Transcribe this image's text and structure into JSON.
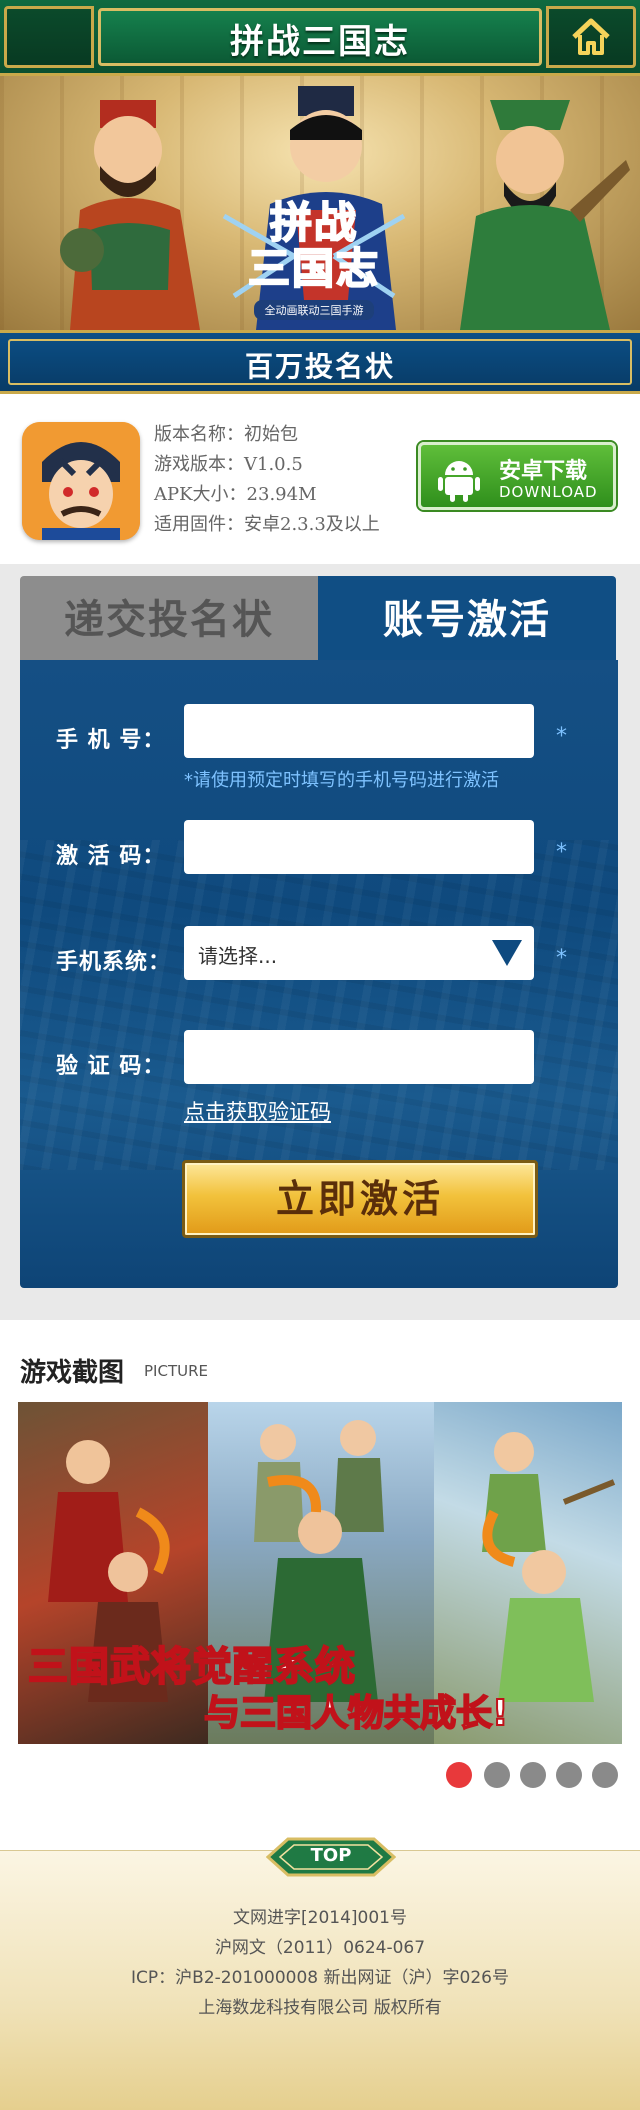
{
  "header": {
    "title": "拼战三国志"
  },
  "hero": {
    "logo_text": "拼战\n三国志",
    "logo_sub": "全动画联动三国手游"
  },
  "ribbon": {
    "label": "百万投名状"
  },
  "app": {
    "version_name": "版本名称：初始包",
    "game_version": "游戏版本：V1.0.5",
    "apk_size": "APK大小：23.94M",
    "firmware": "适用固件：安卓2.3.3及以上",
    "download_cn": "安卓下载",
    "download_en": "DOWNLOAD"
  },
  "tabs": {
    "submit": "递交投名状",
    "activate": "账号激活"
  },
  "form": {
    "phone_label": "手 机 号：",
    "phone_hint": "*请使用预定时填写的手机号码进行激活",
    "code_label": "激 活 码：",
    "os_label": "手机系统：",
    "os_selected": "请选择...",
    "captcha_label": "验 证 码：",
    "get_captcha": "点击获取验证码",
    "required_mark": "*",
    "activate_button": "立即激活"
  },
  "screenshots": {
    "heading": "游戏截图",
    "heading_en": "PICTURE",
    "caption1": "三国武将觉醒系统",
    "caption2": "与三国人物共成长!",
    "dots_count": 5,
    "active_dot": 1
  },
  "footer": {
    "top_label": "TOP",
    "line1": "文网进字[2014]001号",
    "line2": "沪网文（2011）0624-067",
    "line3": "ICP：沪B2-201000008 新出网证（沪）字026号",
    "line4": "上海数龙科技有限公司 版权所有"
  },
  "colors": {
    "header_green": "#0f6a40",
    "gold": "#c9a94a",
    "panel_blue": "#104e84",
    "download_green": "#3a9a24",
    "accent_red": "#e8393b",
    "hint_blue": "#7ec2ff"
  }
}
